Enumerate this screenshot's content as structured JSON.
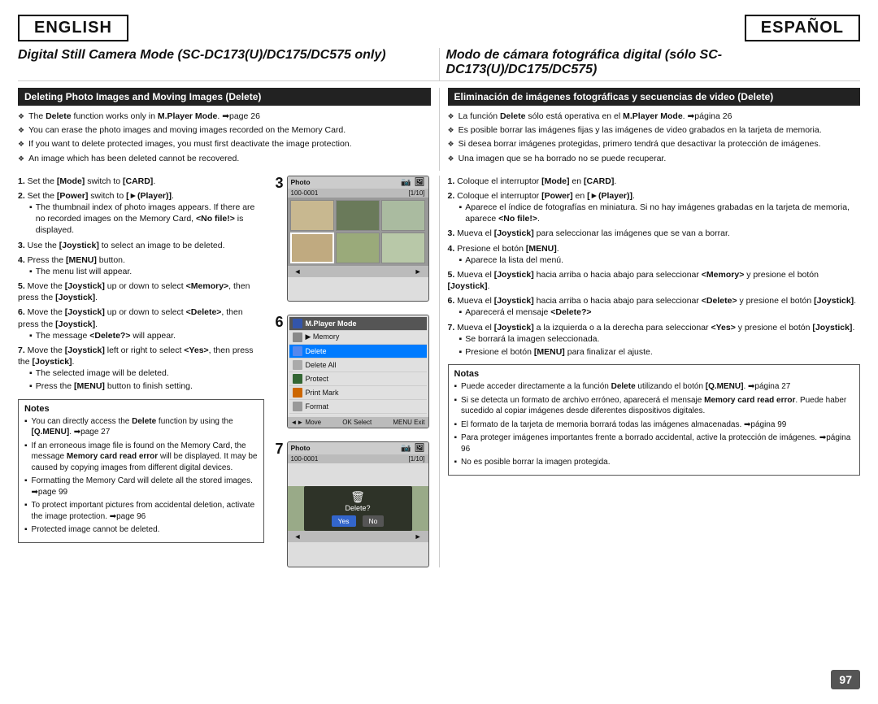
{
  "header": {
    "lang_en": "ENGLISH",
    "lang_es": "ESPAÑOL"
  },
  "main_title": {
    "en": "Digital Still Camera Mode (SC-DC173(U)/DC175/DC575 only)",
    "es": "Modo de cámara fotográfica digital (sólo SC-DC173(U)/DC175/DC575)"
  },
  "section": {
    "en_title": "Deleting Photo Images and Moving Images (Delete)",
    "es_title": "Eliminación de imágenes fotográficas y secuencias de video (Delete)"
  },
  "en_bullets": [
    "The Delete function works only in M.Player Mode. →page 26",
    "You can erase the photo images and moving images recorded on the Memory Card.",
    "If you want to delete protected images, you must first deactivate the image protection.",
    "An image which has been deleted cannot be recovered."
  ],
  "es_bullets": [
    "La función Delete sólo está operativa en el M.Player Mode. →página 26",
    "Es posible borrar las imágenes fijas y las imágenes de video grabados en la tarjeta de memoria.",
    "Si desea borrar imágenes protegidas, primero tendrá que desactivar la protección de imágenes.",
    "Una imagen que se ha borrado no se puede recuperar."
  ],
  "en_steps": [
    {
      "num": "1.",
      "text": "Set the [Mode] switch to [CARD]."
    },
    {
      "num": "2.",
      "text": "Set the [Power] switch to [►(Player)].",
      "sub": [
        "The thumbnail index of photo images appears. If there are no recorded images on the Memory Card, <No file!> is displayed."
      ]
    },
    {
      "num": "3.",
      "text": "Use the [Joystick] to select an image to be deleted."
    },
    {
      "num": "4.",
      "text": "Press the [MENU] button.",
      "sub": [
        "The menu list will appear."
      ]
    },
    {
      "num": "5.",
      "text": "Move the [Joystick] up or down to select <Memory>, then press the [Joystick]."
    },
    {
      "num": "6.",
      "text": "Move the [Joystick] up or down to select <Delete>, then press the [Joystick].",
      "sub": [
        "The message <Delete?> will appear."
      ]
    },
    {
      "num": "7.",
      "text": "Move the [Joystick] left or right to select <Yes>, then press the [Joystick].",
      "sub": [
        "The selected image will be deleted.",
        "Press the [MENU] button to finish setting."
      ]
    }
  ],
  "es_steps": [
    {
      "num": "1.",
      "text": "Coloque el interruptor [Mode] en [CARD]."
    },
    {
      "num": "2.",
      "text": "Coloque el interruptor [Power] en [►(Player)].",
      "sub": [
        "Aparece el índice de fotografías en miniatura. Si no hay imágenes grabadas en la tarjeta de memoria, aparece <No file!>."
      ]
    },
    {
      "num": "3.",
      "text": "Mueva el [Joystick] para seleccionar las imágenes que se van a borrar."
    },
    {
      "num": "4.",
      "text": "Presione el botón [MENU].",
      "sub": [
        "Aparece la lista del menú."
      ]
    },
    {
      "num": "5.",
      "text": "Mueva el [Joystick] hacia arriba o hacia abajo para seleccionar <Memory> y presione el botón [Joystick]."
    },
    {
      "num": "6.",
      "text": "Mueva el [Joystick] hacia arriba o hacia abajo para seleccionar <Delete> y presione el botón [Joystick].",
      "sub": [
        "Aparecerá el mensaje <Delete?>"
      ]
    },
    {
      "num": "7.",
      "text": "Mueva el [Joystick] a la izquierda o a la derecha para seleccionar <Yes> y presione el botón [Joystick].",
      "sub": [
        "Se borrará la imagen seleccionada.",
        "Presione el botón [MENU] para finalizar el ajuste."
      ]
    }
  ],
  "screens": {
    "screen3": {
      "label": "Photo",
      "id": "100-0001",
      "counter": "[1/10]",
      "number": "3"
    },
    "screen6": {
      "number": "6",
      "menu_header": "M.Player Mode",
      "items": [
        "Memory",
        "Delete",
        "Delete All",
        "Protect",
        "Print Mark",
        "Format"
      ],
      "footer": "◄► Move  OK Select  MENU Exit"
    },
    "screen7": {
      "number": "7",
      "label": "Photo",
      "id": "100-0001",
      "counter": "[1/10]",
      "dialog": "Delete?",
      "btn_yes": "Yes",
      "btn_no": "No"
    }
  },
  "notes": {
    "en_title": "Notes",
    "es_title": "Notas",
    "en_items": [
      "You can directly access the Delete function by using the [Q.MENU]. →page 27",
      "If an erroneous image file is found on the Memory Card, the message Memory card read error will be displayed. It may be caused by copying images from different digital devices.",
      "Formatting the Memory Card will delete all the stored images. →page 99",
      "To protect important pictures from accidental deletion, activate the image protection. →page 96",
      "Protected image cannot be deleted."
    ],
    "es_items": [
      "Puede acceder directamente a la función Delete utilizando el botón [Q.MENU]. →página 27",
      "Si se detecta un formato de archivo erróneo, aparecerá el mensaje Memory card read error. Puede haber sucedido al copiar imágenes desde diferentes dispositivos digitales.",
      "El formato de la tarjeta de memoria borrará todas las imágenes almacenadas. →página 99",
      "Para proteger imágenes importantes frente a borrado accidental, active la protección de imágenes. →página 96",
      "No es posible borrar la imagen protegida."
    ]
  },
  "page_number": "97"
}
